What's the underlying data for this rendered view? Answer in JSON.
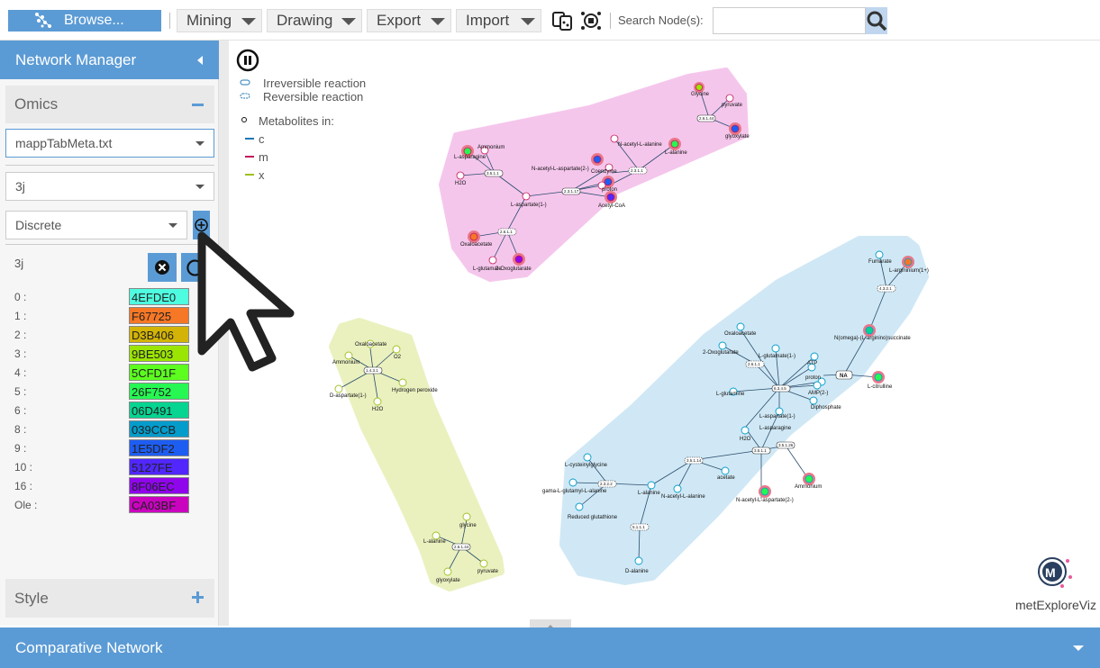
{
  "toolbar": {
    "browse_label": "Browse...",
    "menus": [
      "Mining",
      "Drawing",
      "Export",
      "Import"
    ],
    "search_label": "Search Node(s):",
    "search_value": ""
  },
  "sidebar": {
    "title": "Network Manager",
    "omics_label": "Omics",
    "file_select": "mappTabMeta.txt",
    "condition_select": "3j",
    "mode_select": "Discrete",
    "mapping_title": "3j",
    "color_map": [
      {
        "key": "0 :",
        "color": "#4EFDE0",
        "label": "4EFDE0"
      },
      {
        "key": "1 :",
        "color": "#F67725",
        "label": "F67725"
      },
      {
        "key": "2 :",
        "color": "#D3B406",
        "label": "D3B406"
      },
      {
        "key": "3 :",
        "color": "#9BE503",
        "label": "9BE503"
      },
      {
        "key": "4 :",
        "color": "#5CFD1F",
        "label": "5CFD1F"
      },
      {
        "key": "5 :",
        "color": "#26F752",
        "label": "26F752"
      },
      {
        "key": "6 :",
        "color": "#06D491",
        "label": "06D491"
      },
      {
        "key": "8 :",
        "color": "#039CCB",
        "label": "039CCB"
      },
      {
        "key": "9 :",
        "color": "#1E5DF2",
        "label": "1E5DF2"
      },
      {
        "key": "10 :",
        "color": "#5127FE",
        "label": "5127FE"
      },
      {
        "key": "16 :",
        "color": "#8F06EC",
        "label": "8F06EC"
      },
      {
        "key": "Ole :",
        "color": "#CA03BF",
        "label": "CA03BF"
      }
    ],
    "style_label": "Style"
  },
  "legend": {
    "irreversible": "Irreversible reaction",
    "reversible": "Reversible reaction",
    "metabolites_in": "Metabolites in:",
    "compartments": [
      {
        "name": "c",
        "color": "#1f77b4"
      },
      {
        "name": "m",
        "color": "#c2185b"
      },
      {
        "name": "x",
        "color": "#a0c020"
      }
    ]
  },
  "network": {
    "pink_nodes": [
      "Glycine",
      "pyruvate",
      "glyoxylate",
      "Ammonium",
      "L-asparagine",
      "H2O",
      "N-acetyl-L-aspartate(2-)",
      "N-acetyl-L-alanine",
      "Coenzyme",
      "proton",
      "L-alanine",
      "Acetyl-CoA",
      "L-aspartate(1-)",
      "Oxaloacetate",
      "L-glutamate",
      "2-Oxoglutarate"
    ],
    "pink_reactions": [
      "2.6.1.44",
      "3.5.1.1",
      "2.3.1.17",
      "2.3.1.1",
      "2.6.1.1"
    ],
    "yellow_nodes": [
      "Oxaloacetate",
      "Ammonium",
      "O2",
      "D-aspartate(1-)",
      "Hydrogen peroxide",
      "H2O",
      "glycine",
      "L-alanine",
      "pyruvate",
      "glyoxylate"
    ],
    "yellow_reactions": [
      "1.4.3.1",
      "2.6.1.44"
    ],
    "blue_nodes": [
      "Fumarate",
      "L-argininium(1+)",
      "N(omega)-(L-arginino)succinate",
      "Oxaloacetate",
      "2-Oxoglutarate",
      "L-glutamate(1-)",
      "ATP",
      "proton",
      "AMP(2-)",
      "Diphosphate",
      "L-citrulline",
      "L-glutamine",
      "L-aspartate(1-)",
      "L-asparagine",
      "H2O",
      "L-cysteinylglycine",
      "gama-L-glutamyl-L-alanine",
      "L-alanine",
      "N-acetyl-L-alanine",
      "acetate",
      "Reduced glutathione",
      "N-acetyl-L-aspartate(2-)",
      "Ammonium",
      "D-alanine"
    ],
    "blue_reactions": [
      "4.3.2.1",
      "6.3.4.5",
      "NA",
      "2.6.1.1",
      "6.3.5.4",
      "3.5.1.1",
      "3.5.1.26",
      "3.5.1.14",
      "2.3.2.2",
      "5.1.1.1"
    ]
  },
  "logo": {
    "label": "metExploreViz"
  }
}
